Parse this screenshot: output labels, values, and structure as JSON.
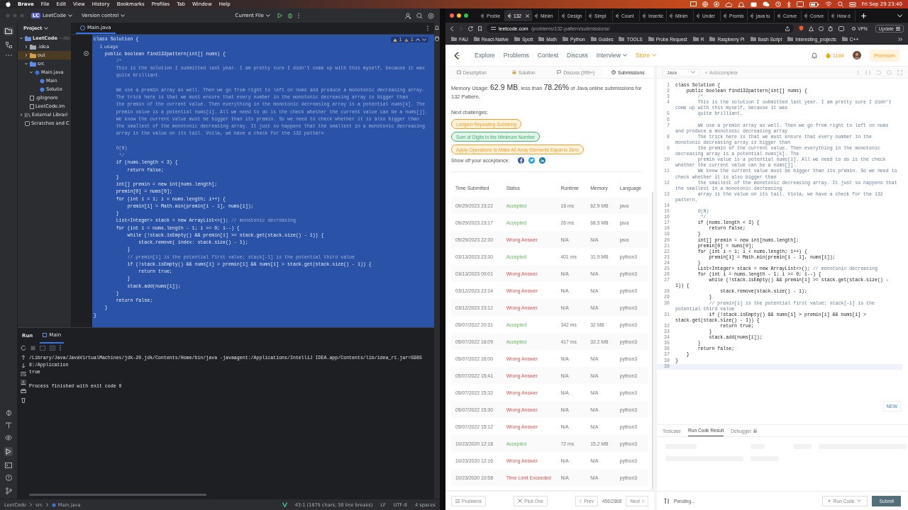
{
  "menubar": {
    "items": [
      "Brave",
      "File",
      "Edit",
      "View",
      "History",
      "Bookmarks",
      "Profiles",
      "Tab",
      "Window",
      "Help"
    ],
    "clock": "Fri Sep 29  23:40"
  },
  "ide": {
    "project_badge": "LC",
    "project": "LeetCode",
    "vcs": "Version control",
    "run_config": "Current File",
    "panel_title": "Project",
    "tree": [
      {
        "label": "LeetCode",
        "hint": "~/de",
        "kind": "module",
        "expanded": true,
        "children": [
          {
            "label": ".idea",
            "kind": "folder",
            "expanded": false
          },
          {
            "label": "out",
            "kind": "excluded",
            "expanded": false
          },
          {
            "label": "src",
            "kind": "source",
            "expanded": true,
            "children": [
              {
                "label": "Main.java",
                "kind": "java",
                "expanded": true,
                "children": [
                  {
                    "label": "Main",
                    "kind": "class"
                  },
                  {
                    "label": "Solutio",
                    "kind": "class"
                  }
                ]
              }
            ]
          },
          {
            "label": ".gitignore",
            "kind": "file"
          },
          {
            "label": "LeetCode.im",
            "kind": "file"
          }
        ]
      },
      {
        "label": "External Librari",
        "kind": "library",
        "expanded": false
      },
      {
        "label": "Scratches and C",
        "kind": "scratch"
      }
    ],
    "tab": "Main.java",
    "warnings": "1",
    "weak_warnings": "1",
    "lines": [
      {
        "kind": "code",
        "text": "class Solution {"
      },
      {
        "kind": "hint",
        "text": "    1 usage"
      },
      {
        "kind": "code",
        "text": "    public boolean find132pattern(int[] nums) {"
      },
      {
        "kind": "comment",
        "text": "        /*"
      },
      {
        "kind": "comment",
        "text": "        This is the solution I submitted last year. I am pretty sure I didn't come up with this myself, because it was"
      },
      {
        "kind": "comment",
        "text": "        quite brilliant."
      },
      {
        "kind": "comment"
      },
      {
        "kind": "comment",
        "text": "        We use a premin array as well. Then we go from right to left on nums and produce a monotonic decreasing array."
      },
      {
        "kind": "comment",
        "text": "        The trick here is that we must ensure that every number in the monotonic decreasing array is bigger than"
      },
      {
        "kind": "comment",
        "text": "        the premin of the current value. Then everything in the monotonic decreasing array is a potential nums[k]. The"
      },
      {
        "kind": "comment",
        "text": "        premin value is a potential nums[i]. All we need to do is the check whether the current value can be a nums[j]."
      },
      {
        "kind": "comment",
        "text": "        We know the current value must be bigger than its premin. So we need to check whether it is also bigger than"
      },
      {
        "kind": "comment",
        "text": "        the smallest of the monotonic decreasing array. It just so happens that the smallest in a monotonic decreasing"
      },
      {
        "kind": "comment",
        "text": "        array is the value on its tail. Voila, we have a check for the 132 pattern"
      },
      {
        "kind": "comment"
      },
      {
        "kind": "comment",
        "text": "        O(N)"
      },
      {
        "kind": "comment",
        "text": "         */"
      },
      {
        "kind": "code",
        "text": "        if (nums.length < 3) {"
      },
      {
        "kind": "code",
        "text": "            return false;"
      },
      {
        "kind": "code",
        "text": "        }"
      },
      {
        "kind": "code",
        "text": "        int[] premin = new int[nums.length];"
      },
      {
        "kind": "code",
        "text": "        premin[0] = nums[0];"
      },
      {
        "kind": "code",
        "text": "        for (int i = 1; i < nums.length; i++) {"
      },
      {
        "kind": "code",
        "text": "            premin[i] = Math.min(premin[i - 1], nums[i]);"
      },
      {
        "kind": "code",
        "text": "        }"
      },
      {
        "kind": "code",
        "text": "        List<Integer> stack = new ArrayList<>();",
        "comment": " // monotonic decreasing"
      },
      {
        "kind": "code",
        "text": "        for (int i = nums.length - 1; i >= 0; i--) {"
      },
      {
        "kind": "code",
        "text": "            while (!stack.isEmpty() && premin[i] >= stack.get(stack.size() - 1)) {"
      },
      {
        "kind": "code",
        "text": "                stack.remove( index: stack.size() - 1);"
      },
      {
        "kind": "code",
        "text": "            }"
      },
      {
        "kind": "comment",
        "text": "            // premin[i] is the potential first value; stack[-1] is the potential third value"
      },
      {
        "kind": "code",
        "text": "            if (!stack.isEmpty() && nums[i] > premin[i] && nums[i] > stack.get(stack.size() - 1)) {"
      },
      {
        "kind": "code",
        "text": "                return true;"
      },
      {
        "kind": "code",
        "text": "            }"
      },
      {
        "kind": "code",
        "text": "            stack.add(nums[i]);"
      },
      {
        "kind": "code",
        "text": "        }"
      },
      {
        "kind": "code",
        "text": "        return false;"
      },
      {
        "kind": "code",
        "text": "    }"
      },
      {
        "kind": "code",
        "text": "}"
      }
    ],
    "run_label": "Run",
    "run_tab": "Main",
    "console": [
      {
        "kind": "out",
        "text": "/Library/Java/JavaVirtualMachines/jdk-20.jdk/Contents/Home/bin/java -javaagent:/Applications/IntelliJ IDEA.app/Contents/lib/idea_rt.jar=59858:/Application"
      },
      {
        "kind": "out",
        "text": "true"
      },
      {
        "kind": "exit",
        "text": "Process finished with exit code 0"
      }
    ],
    "breadcrumbs": [
      "LeetCode",
      "src",
      "Main.java"
    ],
    "status": [
      "43:1 (1875 chars, 38 line breaks)",
      "LF",
      "UTF-8",
      "4 spaces"
    ]
  },
  "browser": {
    "tabs": [
      {
        "label": "Proble",
        "selected": false
      },
      {
        "label": "132",
        "selected": true
      },
      {
        "label": "Minim",
        "selected": false
      },
      {
        "label": "Design",
        "selected": false
      },
      {
        "label": "Simpl",
        "selected": false
      },
      {
        "label": "Count",
        "selected": false
      },
      {
        "label": "Insertic",
        "selected": false
      },
      {
        "label": "Minim",
        "selected": false
      },
      {
        "label": "Under",
        "selected": false
      },
      {
        "label": "Promis",
        "selected": false
      },
      {
        "label": "java tu",
        "selected": false
      },
      {
        "label": "Conve",
        "selected": false
      },
      {
        "label": "Conve",
        "selected": false
      },
      {
        "label": "How d",
        "selected": false
      }
    ],
    "url_host": "leetcode.com",
    "url_path": "/problems/132-pattern/submissions/",
    "vpn": "VPN",
    "update": "Update",
    "bookmarks": [
      "FAU",
      "React-Native",
      "Spott",
      "Math",
      "Python",
      "Guides",
      "TOOLS",
      "Probe Request",
      "R",
      "Raspberry Pi",
      "Bash Script",
      "Interesting_projects",
      "C++"
    ]
  },
  "leetcode": {
    "nav": [
      {
        "label": "Explore",
        "kind": "link"
      },
      {
        "label": "Problems",
        "kind": "link"
      },
      {
        "label": "Contest",
        "kind": "link"
      },
      {
        "label": "Discuss",
        "kind": "link"
      },
      {
        "label": "Interview",
        "kind": "menu"
      },
      {
        "label": "Store",
        "kind": "store"
      }
    ],
    "coins": "1184",
    "premium": "Premium",
    "panel_tabs": [
      {
        "label": "Description",
        "selected": false
      },
      {
        "label": "Solution",
        "selected": false
      },
      {
        "label": "Discuss (999+)",
        "selected": false
      },
      {
        "label": "Submissions",
        "selected": true
      }
    ],
    "memory_text": "Memory Usage: **62.9 MB**, less than **78.26%** of Java online submissions for 132 Pattern.",
    "next_label": "Next challenges:",
    "challenges": [
      {
        "label": "Longest Repeating Substring",
        "color": "#f0a020"
      },
      {
        "label": "Sum of Digits in the Minimum Number",
        "color": "#3cb371"
      },
      {
        "label": "Apply Operations to Make All Array Elements Equal to Zero",
        "color": "#f0a020"
      }
    ],
    "share_label": "Show off your acceptance:",
    "columns": [
      "Time Submitted",
      "Status",
      "Runtime",
      "Memory",
      "Language"
    ],
    "rows": [
      {
        "kind": "accepted",
        "cells": [
          "09/29/2023 23:22",
          "Accepted",
          "16 ms",
          "62.9 MB",
          "java"
        ]
      },
      {
        "kind": "accepted",
        "cells": [
          "09/29/2023 23:17",
          "Accepted",
          "26 ms",
          "68.5 MB",
          "java"
        ]
      },
      {
        "kind": "wrong",
        "cells": [
          "09/29/2023 22:30",
          "Wrong Answer",
          "N/A",
          "N/A",
          "java"
        ]
      },
      {
        "kind": "accepted",
        "cells": [
          "03/13/2023 23:30",
          "Accepted",
          "401 ms",
          "31.9 MB",
          "python3"
        ]
      },
      {
        "kind": "wrong",
        "cells": [
          "03/13/2023 00:01",
          "Wrong Answer",
          "N/A",
          "N/A",
          "python3"
        ]
      },
      {
        "kind": "wrong",
        "cells": [
          "03/12/2023 23:14",
          "Wrong Answer",
          "N/A",
          "N/A",
          "python3"
        ]
      },
      {
        "kind": "wrong",
        "cells": [
          "03/12/2023 23:12",
          "Wrong Answer",
          "N/A",
          "N/A",
          "python3"
        ]
      },
      {
        "kind": "accepted",
        "cells": [
          "05/07/2022 20:31",
          "Accepted",
          "342 ms",
          "32 MB",
          "python3"
        ]
      },
      {
        "kind": "accepted",
        "cells": [
          "05/07/2022 16:09",
          "Accepted",
          "417 ms",
          "32.2 MB",
          "python3"
        ]
      },
      {
        "kind": "wrong",
        "cells": [
          "05/07/2022 16:00",
          "Wrong Answer",
          "N/A",
          "N/A",
          "python3"
        ]
      },
      {
        "kind": "wrong",
        "cells": [
          "05/07/2022 15:41",
          "Wrong Answer",
          "N/A",
          "N/A",
          "python3"
        ]
      },
      {
        "kind": "wrong",
        "cells": [
          "05/07/2022 15:32",
          "Wrong Answer",
          "N/A",
          "N/A",
          "python3"
        ]
      },
      {
        "kind": "wrong",
        "cells": [
          "05/07/2022 15:30",
          "Wrong Answer",
          "N/A",
          "N/A",
          "python3"
        ]
      },
      {
        "kind": "wrong",
        "cells": [
          "05/07/2022 15:12",
          "Wrong Answer",
          "N/A",
          "N/A",
          "python3"
        ]
      },
      {
        "kind": "accepted",
        "cells": [
          "10/23/2020 12:18",
          "Accepted",
          "72 ms",
          "15.2 MB",
          "python3"
        ]
      },
      {
        "kind": "wrong",
        "cells": [
          "10/23/2020 12:16",
          "Wrong Answer",
          "N/A",
          "N/A",
          "python3"
        ]
      },
      {
        "kind": "tle",
        "cells": [
          "10/23/2020 10:58",
          "Time Limit Exceeded",
          "N/A",
          "N/A",
          "python3"
        ]
      }
    ],
    "footer": {
      "problems": "Problems",
      "pick": "Pick One",
      "prev": "Prev",
      "page": "456/2868",
      "next": "Next"
    },
    "language": "Java",
    "autocomplete": "Autocomplete",
    "code": [
      {
        "n": "1",
        "kind": "code",
        "text": "class Solution {"
      },
      {
        "n": "2",
        "kind": "code",
        "text": "    public boolean find132pattern(int[] nums) {"
      },
      {
        "n": "3",
        "kind": "comment",
        "text": "        /*"
      },
      {
        "n": "4",
        "kind": "comment",
        "text": "        This is the solution I submitted last year. I am pretty sure I didn't come up with this myself, because it was"
      },
      {
        "n": "5",
        "kind": "comment",
        "text": "        quite brilliant."
      },
      {
        "n": "6",
        "kind": "comment"
      },
      {
        "n": "7",
        "kind": "comment",
        "text": "        We use a premin array as well. Then we go from right to left on nums and produce a monotonic decreasing array"
      },
      {
        "n": "8",
        "kind": "comment",
        "text": "        The trick here is that we must ensure that every number in the monotonic decreasing array is bigger than"
      },
      {
        "n": "9",
        "kind": "comment",
        "text": "        the premin of the current value. Then everything in the monotonic decreasing array is a potential nums[k]. The"
      },
      {
        "n": "10",
        "kind": "comment",
        "text": "        premin value is a potential nums[i]. All we need to do is the check whether the current value can be a nums[j]."
      },
      {
        "n": "11",
        "kind": "comment",
        "text": "        We know the current value must be bigger than its premin. So we need to check whether it is also bigger than"
      },
      {
        "n": "12",
        "kind": "comment",
        "text": "        the smallest of the monotonic decreasing array. It just so happens that the smallest in a monotonic decreasing"
      },
      {
        "n": "13",
        "kind": "comment",
        "text": "        array is the value on its tail. Viola, we have a check for the 132 pattern."
      },
      {
        "n": "14",
        "kind": "comment"
      },
      {
        "n": "15",
        "kind": "comment",
        "text": "        O(N)"
      },
      {
        "n": "16",
        "kind": "comment",
        "text": "         */"
      },
      {
        "n": "17",
        "kind": "code",
        "text": "        if (nums.length < 3) {"
      },
      {
        "n": "18",
        "kind": "code",
        "text": "            return false;"
      },
      {
        "n": "19",
        "kind": "code",
        "text": "        }"
      },
      {
        "n": "20",
        "kind": "code",
        "text": "        int[] premin = new int[nums.length];"
      },
      {
        "n": "21",
        "kind": "code",
        "text": "        premin[0] = nums[0];"
      },
      {
        "n": "22",
        "kind": "code",
        "text": "        for (int i = 1; i < nums.length; i++) {"
      },
      {
        "n": "23",
        "kind": "code",
        "text": "            premin[i] = Math.min(premin[i - 1], nums[i]);"
      },
      {
        "n": "24",
        "kind": "code",
        "text": "        }"
      },
      {
        "n": "25",
        "kind": "code",
        "text": "        List<Integer> stack = new ArrayList<>();",
        "comment": " // monotonic decreasing"
      },
      {
        "n": "26",
        "kind": "code",
        "text": "        for (int i = nums.length - 1; i >= 0; i--) {"
      },
      {
        "n": "27",
        "kind": "code",
        "text": "            while (!stack.isEmpty() && premin[i] >= stack.get(stack.size() - 1)) {"
      },
      {
        "n": "28",
        "kind": "code",
        "text": "                stack.remove(stack.size() - 1);"
      },
      {
        "n": "29",
        "kind": "code",
        "text": "            }"
      },
      {
        "n": "30",
        "kind": "comment",
        "text": "            // premin[i] is the potential first value; stack[-1] is the potential third value"
      },
      {
        "n": "31",
        "kind": "code",
        "text": "            if (!stack.isEmpty() && nums[i] > premin[i] && nums[i] > stack.get(stack.size() - 1)) {"
      },
      {
        "n": "32",
        "kind": "code",
        "text": "                return true;"
      },
      {
        "n": "33",
        "kind": "code",
        "text": "            }"
      },
      {
        "n": "34",
        "kind": "code",
        "text": "            stack.add(nums[i]);"
      },
      {
        "n": "35",
        "kind": "code",
        "text": "        }"
      },
      {
        "n": "36",
        "kind": "code",
        "text": "        return false;"
      },
      {
        "n": "37",
        "kind": "code",
        "text": "    }"
      },
      {
        "n": "38",
        "kind": "code",
        "text": "}"
      },
      {
        "n": "39",
        "kind": "code"
      }
    ],
    "new_badge": "NEW",
    "result_tabs": [
      {
        "label": "Testcase",
        "selected": false
      },
      {
        "label": "Run Code Result",
        "selected": true
      },
      {
        "label": "Debugger",
        "selected": false,
        "locked": true
      }
    ],
    "status": "Pending...",
    "run": "Run Code",
    "submit": "Submit"
  }
}
